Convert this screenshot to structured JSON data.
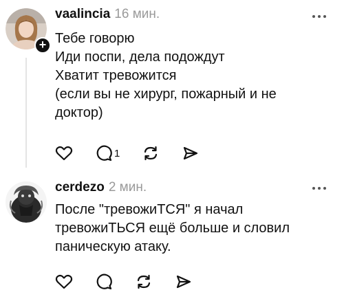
{
  "posts": [
    {
      "username": "vaalincia",
      "time": "16 мин.",
      "lines": [
        "Тебе говорю",
        "Иди поспи, дела подождут",
        "Хватит тревожится",
        "(если вы не хирург, пожарный и не",
        "доктор)"
      ],
      "reply_count": "1",
      "follow_badge": "+"
    },
    {
      "username": "cerdezo",
      "time": "2 мин.",
      "lines": [
        "После \"тревожиТСЯ\" я начал",
        "тревожиТЬСЯ ещё больше и словил",
        "паническую атаку."
      ]
    }
  ],
  "icons": {
    "like": "heart-icon",
    "reply": "comment-icon",
    "repost": "repost-icon",
    "share": "send-icon",
    "more": "more-icon"
  }
}
